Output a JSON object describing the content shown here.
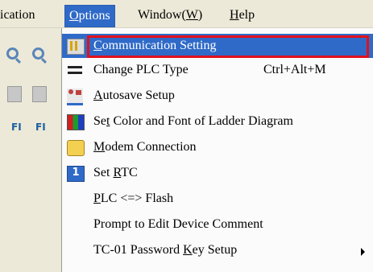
{
  "menubar": {
    "items": [
      {
        "label": "ication"
      },
      {
        "label": "Options",
        "accel": "O",
        "rest": "ptions"
      },
      {
        "label": "Window(W)",
        "pre": "Window(",
        "accel": "W",
        "post": ")"
      },
      {
        "label": "Help",
        "accel": "H",
        "rest": "elp"
      }
    ]
  },
  "toolbar": {
    "icons": [
      "zoom-in-icon",
      "zoom-out-icon",
      "document-icon",
      "document-icon",
      "fil-icon",
      "fil-icon"
    ],
    "fil_text": "FI",
    "fil2_text": "FI"
  },
  "dropdown": {
    "items": [
      {
        "label": "Communication Setting",
        "accel": "C",
        "rest": "ommunication Setting",
        "icon": "communication-icon",
        "highlighted": true
      },
      {
        "label": "Change PLC Type",
        "shortcut": "Ctrl+Alt+M",
        "icon": "plc-type-icon"
      },
      {
        "label": "Autosave Setup",
        "accel": "A",
        "rest": "utosave Setup",
        "icon": "autosave-icon"
      },
      {
        "label": "Set Color and Font of Ladder Diagram",
        "pre": "Se",
        "accel": "t",
        "rest": " Color and Font of Ladder Diagram",
        "icon": "color-icon"
      },
      {
        "label": "Modem Connection",
        "accel": "M",
        "rest": "odem Connection",
        "icon": "modem-icon"
      },
      {
        "label": "Set RTC",
        "pre": "Set ",
        "accel": "R",
        "rest": "TC",
        "icon": "rtc-icon",
        "icon_text": "1"
      },
      {
        "label": "PLC <=> Flash",
        "accel": "P",
        "rest": "LC <=> Flash"
      },
      {
        "label": "Prompt to Edit Device Comment"
      },
      {
        "label": "TC-01 Password Key Setup",
        "pre": "TC-01 Password ",
        "accel": "K",
        "rest": "ey Setup",
        "submenu": true
      }
    ]
  },
  "colors": {
    "selection": "#2f6ac8",
    "highlight_box": "#e0111d",
    "menu_bg": "#fbfbfb",
    "bar_bg": "#ece9d8"
  }
}
